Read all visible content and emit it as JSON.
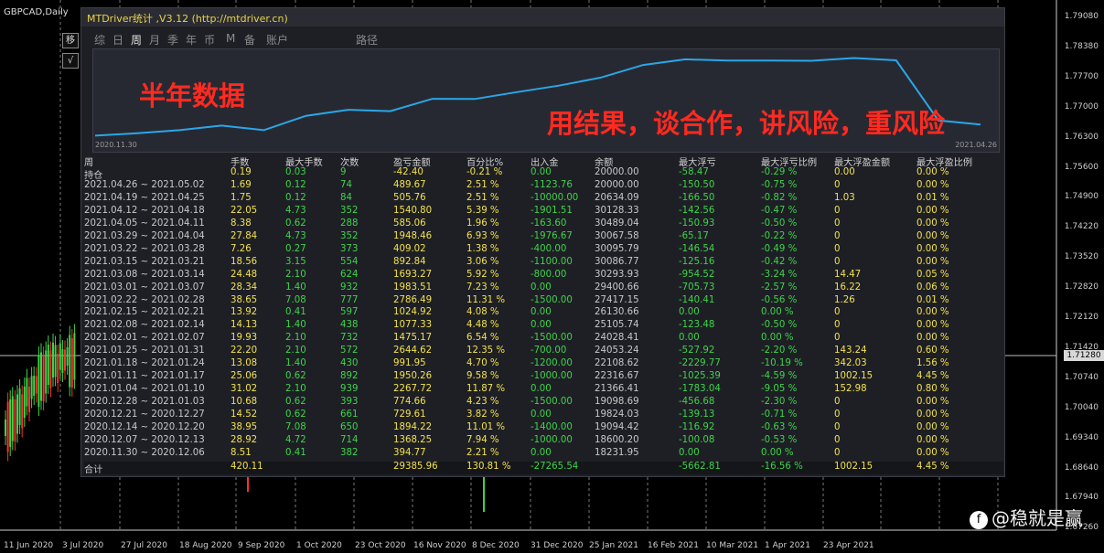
{
  "symbol": "GBPCAD,Daily",
  "left_buttons": [
    "移",
    "√"
  ],
  "price_axis": [
    "1.79080",
    "1.78380",
    "1.77700",
    "1.77000",
    "1.76300",
    "1.75600",
    "1.74900",
    "1.74220",
    "1.73520",
    "1.72820",
    "1.72120",
    "1.71420",
    "1.70740",
    "1.70040",
    "1.69340",
    "1.68640",
    "1.67940",
    "1.67260"
  ],
  "current_price": "1.71280",
  "date_axis": [
    "11 Jun 2020",
    "3 Jul 2020",
    "27 Jul 2020",
    "18 Aug 2020",
    "9 Sep 2020",
    "1 Oct 2020",
    "23 Oct 2020",
    "16 Nov 2020",
    "8 Dec 2020",
    "31 Dec 2020",
    "25 Jan 2021",
    "16 Feb 2021",
    "10 Mar 2021",
    "1 Apr 2021",
    "23 Apr 2021"
  ],
  "panel": {
    "title": "MTDriver统计 ,V3.12 (http://mtdriver.cn)",
    "tabs": [
      "综",
      "日",
      "周",
      "月",
      "季",
      "年",
      "币",
      "M",
      "备",
      "账户",
      "路径"
    ],
    "active_tab": "周",
    "graph_start_date": "2020.11.30",
    "graph_end_date": "2021.04.26",
    "annotation_1": "半年数据",
    "annotation_2": "用结果，谈合作，讲风险，重风险",
    "curve_color": "#2aa7e8"
  },
  "table": {
    "headers": [
      "周",
      "手数",
      "最大手数",
      "次数",
      "盈亏金额",
      "百分比%",
      "出入金",
      "余额",
      "最大浮亏",
      "最大浮亏比例",
      "最大浮盈金额",
      "最大浮盈比例"
    ],
    "rows": [
      [
        "持仓",
        "0.19",
        "0.03",
        "9",
        "-42.40",
        "-0.21 %",
        "0.00",
        "20000.00",
        "-58.47",
        "-0.29 %",
        "0.00",
        "0.00 %"
      ],
      [
        "2021.04.26 ~ 2021.05.02",
        "1.69",
        "0.12",
        "74",
        "489.67",
        "2.51 %",
        "-1123.76",
        "20000.00",
        "-150.50",
        "-0.75 %",
        "0",
        "0.00 %"
      ],
      [
        "2021.04.19 ~ 2021.04.25",
        "1.75",
        "0.12",
        "84",
        "505.76",
        "2.51 %",
        "-10000.00",
        "20634.09",
        "-166.50",
        "-0.82 %",
        "1.03",
        "0.01 %"
      ],
      [
        "2021.04.12 ~ 2021.04.18",
        "22.05",
        "4.73",
        "352",
        "1540.80",
        "5.39 %",
        "-1901.51",
        "30128.33",
        "-142.56",
        "-0.47 %",
        "0",
        "0.00 %"
      ],
      [
        "2021.04.05 ~ 2021.04.11",
        "8.38",
        "0.62",
        "288",
        "585.06",
        "1.96 %",
        "-163.60",
        "30489.04",
        "-150.93",
        "-0.50 %",
        "0",
        "0.00 %"
      ],
      [
        "2021.03.29 ~ 2021.04.04",
        "27.84",
        "4.73",
        "352",
        "1948.46",
        "6.93 %",
        "-1976.67",
        "30067.58",
        "-65.17",
        "-0.22 %",
        "0",
        "0.00 %"
      ],
      [
        "2021.03.22 ~ 2021.03.28",
        "7.26",
        "0.27",
        "373",
        "409.02",
        "1.38 %",
        "-400.00",
        "30095.79",
        "-146.54",
        "-0.49 %",
        "0",
        "0.00 %"
      ],
      [
        "2021.03.15 ~ 2021.03.21",
        "18.56",
        "3.15",
        "554",
        "892.84",
        "3.06 %",
        "-1100.00",
        "30086.77",
        "-125.16",
        "-0.42 %",
        "0",
        "0.00 %"
      ],
      [
        "2021.03.08 ~ 2021.03.14",
        "24.48",
        "2.10",
        "624",
        "1693.27",
        "5.92 %",
        "-800.00",
        "30293.93",
        "-954.52",
        "-3.24 %",
        "14.47",
        "0.05 %"
      ],
      [
        "2021.03.01 ~ 2021.03.07",
        "28.34",
        "1.40",
        "932",
        "1983.51",
        "7.23 %",
        "0.00",
        "29400.66",
        "-705.73",
        "-2.57 %",
        "16.22",
        "0.06 %"
      ],
      [
        "2021.02.22 ~ 2021.02.28",
        "38.65",
        "7.08",
        "777",
        "2786.49",
        "11.31 %",
        "-1500.00",
        "27417.15",
        "-140.41",
        "-0.56 %",
        "1.26",
        "0.01 %"
      ],
      [
        "2021.02.15 ~ 2021.02.21",
        "13.92",
        "0.41",
        "597",
        "1024.92",
        "4.08 %",
        "0.00",
        "26130.66",
        "0.00",
        "0.00 %",
        "0",
        "0.00 %"
      ],
      [
        "2021.02.08 ~ 2021.02.14",
        "14.13",
        "1.40",
        "438",
        "1077.33",
        "4.48 %",
        "0.00",
        "25105.74",
        "-123.48",
        "-0.50 %",
        "0",
        "0.00 %"
      ],
      [
        "2021.02.01 ~ 2021.02.07",
        "19.93",
        "2.10",
        "732",
        "1475.17",
        "6.54 %",
        "-1500.00",
        "24028.41",
        "0.00",
        "0.00 %",
        "0",
        "0.00 %"
      ],
      [
        "2021.01.25 ~ 2021.01.31",
        "22.20",
        "2.10",
        "572",
        "2644.62",
        "12.35 %",
        "-700.00",
        "24053.24",
        "-527.92",
        "-2.20 %",
        "143.24",
        "0.60 %"
      ],
      [
        "2021.01.18 ~ 2021.01.24",
        "13.08",
        "1.40",
        "430",
        "991.95",
        "4.70 %",
        "-1200.00",
        "22108.62",
        "-2229.77",
        "-10.19 %",
        "342.03",
        "1.56 %"
      ],
      [
        "2021.01.11 ~ 2021.01.17",
        "25.06",
        "0.62",
        "892",
        "1950.26",
        "9.58 %",
        "-1000.00",
        "22316.67",
        "-1025.39",
        "-4.59 %",
        "1002.15",
        "4.45 %"
      ],
      [
        "2021.01.04 ~ 2021.01.10",
        "31.02",
        "2.10",
        "939",
        "2267.72",
        "11.87 %",
        "0.00",
        "21366.41",
        "-1783.04",
        "-9.05 %",
        "152.98",
        "0.80 %"
      ],
      [
        "2020.12.28 ~ 2021.01.03",
        "10.68",
        "0.62",
        "393",
        "774.66",
        "4.23 %",
        "-1500.00",
        "19098.69",
        "-456.68",
        "-2.30 %",
        "0",
        "0.00 %"
      ],
      [
        "2020.12.21 ~ 2020.12.27",
        "14.52",
        "0.62",
        "661",
        "729.61",
        "3.82 %",
        "0.00",
        "19824.03",
        "-139.13",
        "-0.71 %",
        "0",
        "0.00 %"
      ],
      [
        "2020.12.14 ~ 2020.12.20",
        "38.95",
        "7.08",
        "650",
        "1894.22",
        "11.01 %",
        "-1400.00",
        "19094.42",
        "-116.92",
        "-0.63 %",
        "0",
        "0.00 %"
      ],
      [
        "2020.12.07 ~ 2020.12.13",
        "28.92",
        "4.72",
        "714",
        "1368.25",
        "7.94 %",
        "-1000.00",
        "18600.20",
        "-100.08",
        "-0.53 %",
        "0",
        "0.00 %"
      ],
      [
        "2020.11.30 ~ 2020.12.06",
        "8.51",
        "0.41",
        "382",
        "394.77",
        "2.21 %",
        "0.00",
        "18231.95",
        "0.00",
        "0.00 %",
        "0",
        "0.00 %"
      ]
    ],
    "summary": [
      "合计",
      "420.11",
      "",
      "",
      "29385.96",
      "130.81 %",
      "-27265.54",
      "",
      "-5662.81",
      "-16.56 %",
      "1002.15",
      "4.45 %"
    ]
  },
  "watermark": "@稳就是赢",
  "colors": {
    "label": "#c8c8c8",
    "yellow": "#f2e24c",
    "green": "#3ed44a",
    "header": "#d0d0d0"
  }
}
